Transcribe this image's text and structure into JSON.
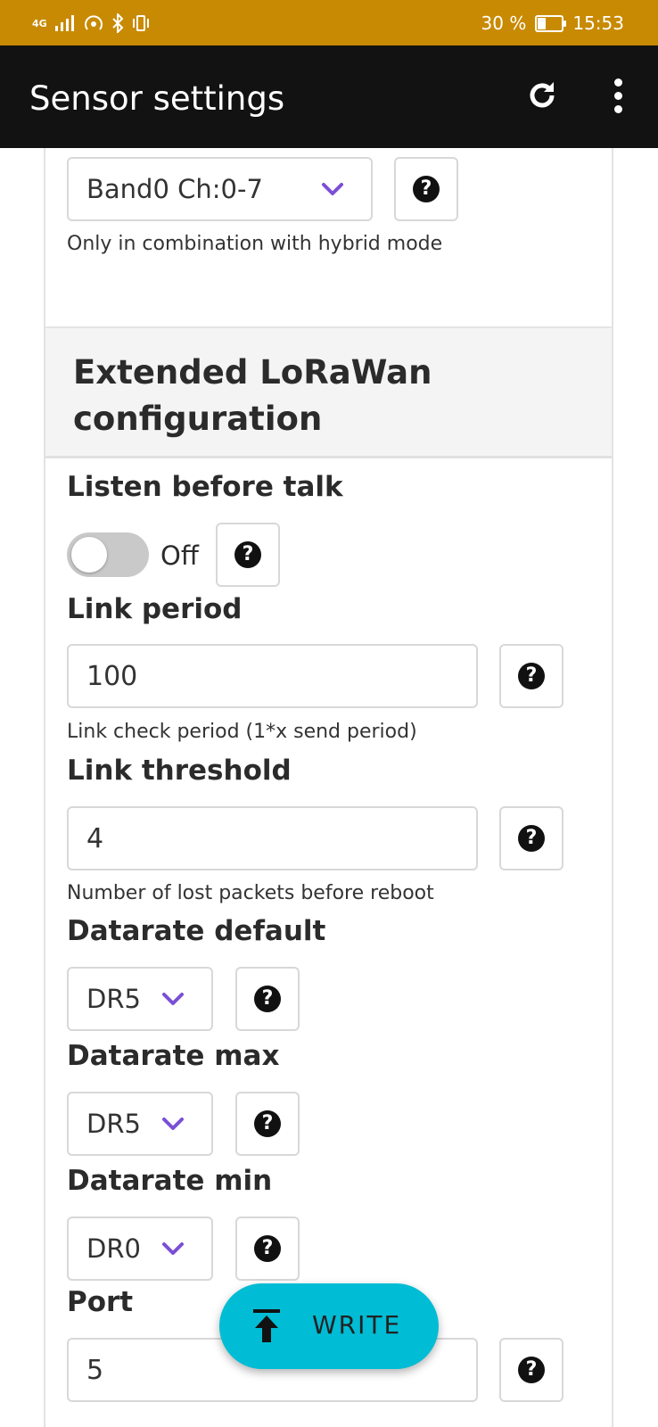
{
  "status_bar": {
    "network": "4G",
    "battery_percent": "30 %",
    "battery_level": 0.3,
    "time": "15:53"
  },
  "app_bar": {
    "title": "Sensor settings",
    "refresh_icon": "refresh-icon",
    "menu_icon": "more-vert-icon"
  },
  "band_section": {
    "selected": "Band0 Ch:0-7",
    "hint": "Only in combination with hybrid mode"
  },
  "extended": {
    "title": "Extended LoRaWan configuration",
    "listen_before_talk": {
      "label": "Listen before talk",
      "state": "Off",
      "enabled": false
    },
    "link_period": {
      "label": "Link period",
      "value": "100",
      "hint": "Link check period (1*x send period)"
    },
    "link_threshold": {
      "label": "Link threshold",
      "value": "4",
      "hint": "Number of lost packets before reboot"
    },
    "datarate_default": {
      "label": "Datarate default",
      "selected": "DR5"
    },
    "datarate_max": {
      "label": "Datarate max",
      "selected": "DR5"
    },
    "datarate_min": {
      "label": "Datarate min",
      "selected": "DR0"
    },
    "port": {
      "label": "Port",
      "value": "5"
    }
  },
  "fab": {
    "label": "WRITE",
    "icon": "upload-icon"
  },
  "colors": {
    "status_bar": "#c88a02",
    "app_bar": "#121212",
    "accent_chevron": "#7b4fd6",
    "fab": "#00bcd4"
  }
}
